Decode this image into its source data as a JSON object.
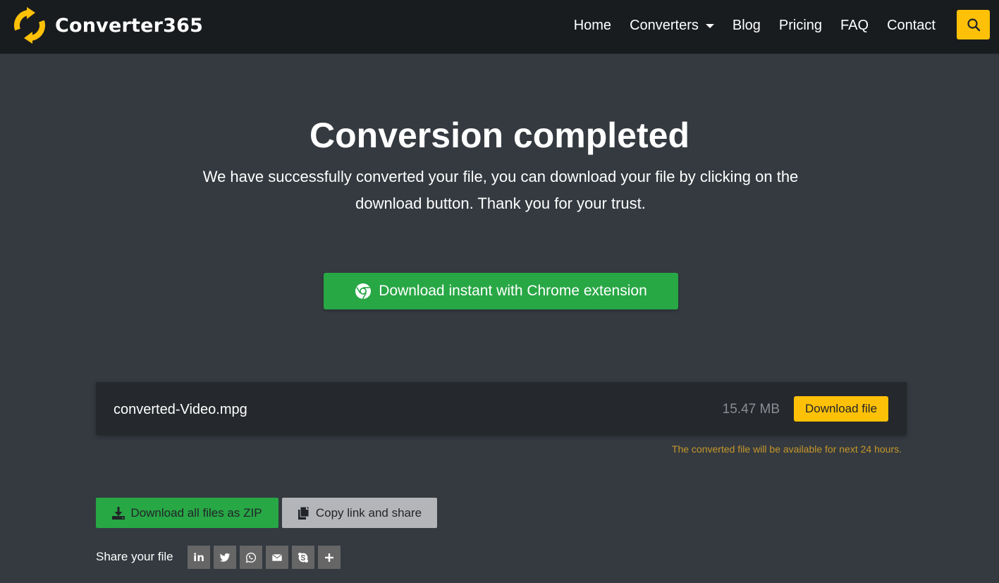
{
  "header": {
    "brand_name": "Converter365",
    "nav": [
      {
        "label": "Home"
      },
      {
        "label": "Converters",
        "has_dropdown": true
      },
      {
        "label": "Blog"
      },
      {
        "label": "Pricing"
      },
      {
        "label": "FAQ"
      },
      {
        "label": "Contact"
      }
    ],
    "search_icon": "search-icon"
  },
  "main": {
    "title": "Conversion completed",
    "subtitle_line1": "We have successfully converted your file, you can download your file by clicking on the",
    "subtitle_line2": "download button. Thank you for your trust.",
    "chrome_button_label": "Download instant with Chrome extension"
  },
  "file": {
    "name": "converted-Video.mpg",
    "size": "15.47 MB",
    "download_label": "Download file",
    "availability_note": "The converted file will be available for next 24 hours."
  },
  "actions": {
    "zip_label": "Download all files as ZIP",
    "copy_label": "Copy link and share"
  },
  "share": {
    "label": "Share your file",
    "icons": [
      "linkedin-icon",
      "twitter-icon",
      "whatsapp-icon",
      "email-icon",
      "skype-icon",
      "plus-icon"
    ]
  },
  "colors": {
    "accent_yellow": "#ffc107",
    "success_green": "#28a745",
    "background": "#343a40",
    "navbar": "#191c1f",
    "note_amber": "#c7972a"
  }
}
